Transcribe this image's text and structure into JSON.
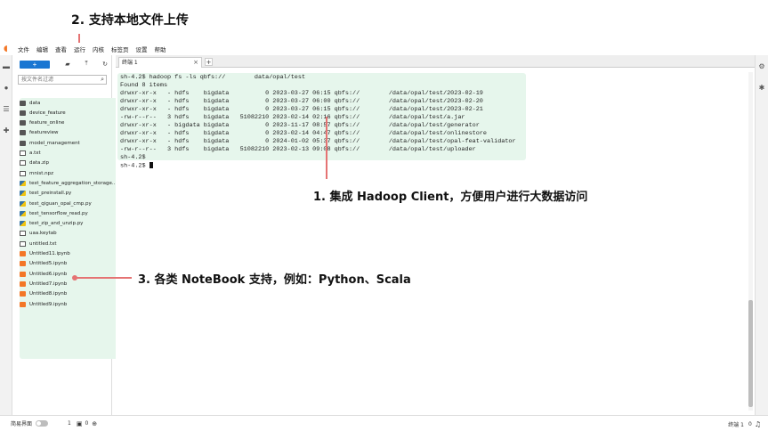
{
  "annotations": {
    "upload": "2. 支持本地文件上传",
    "hadoop": "1. 集成 Hadoop Client，方便用户进行大数据访问",
    "notebook": "3. 各类 NoteBook 支持，例如：Python、Scala"
  },
  "menu": [
    "文件",
    "编辑",
    "查看",
    "运行",
    "内核",
    "标签页",
    "设置",
    "帮助"
  ],
  "filebrowser": {
    "new_label": "+",
    "filter_placeholder": "按文件名过滤",
    "items": [
      {
        "name": "data",
        "type": "folder"
      },
      {
        "name": "device_feature",
        "type": "folder"
      },
      {
        "name": "feature_online",
        "type": "folder"
      },
      {
        "name": "featureview",
        "type": "folder"
      },
      {
        "name": "model_management",
        "type": "folder"
      },
      {
        "name": "a.txt",
        "type": "file"
      },
      {
        "name": "data.zip",
        "type": "file"
      },
      {
        "name": "mnist.npz",
        "type": "file"
      },
      {
        "name": "test_feature_aggregation_storage...",
        "type": "py"
      },
      {
        "name": "test_preinstall.py",
        "type": "py"
      },
      {
        "name": "test_qiguan_opal_cmp.py",
        "type": "py"
      },
      {
        "name": "test_tensorflow_read.py",
        "type": "py"
      },
      {
        "name": "test_zip_and_unzip.py",
        "type": "py"
      },
      {
        "name": "uaa.keytab",
        "type": "file"
      },
      {
        "name": "untitled.txt",
        "type": "file"
      },
      {
        "name": "Untitled11.ipynb",
        "type": "nb"
      },
      {
        "name": "Untitled5.ipynb",
        "type": "nb"
      },
      {
        "name": "Untitled6.ipynb",
        "type": "nb"
      },
      {
        "name": "Untitled7.ipynb",
        "type": "nb"
      },
      {
        "name": "Untitled8.ipynb",
        "type": "nb"
      },
      {
        "name": "Untitled9.ipynb",
        "type": "nb"
      }
    ]
  },
  "tab": {
    "label": "终端 1",
    "close": "×",
    "add": "+"
  },
  "terminal": {
    "lines": [
      "sh-4.2$ hadoop fs -ls qbfs://        data/opal/test",
      "Found 8 items",
      "drwxr-xr-x   - hdfs    bigdata          0 2023-03-27 06:15 qbfs://        /data/opal/test/2023-02-19",
      "drwxr-xr-x   - hdfs    bigdata          0 2023-03-27 06:00 qbfs://        /data/opal/test/2023-02-20",
      "drwxr-xr-x   - hdfs    bigdata          0 2023-03-27 06:15 qbfs://        /data/opal/test/2023-02-21",
      "-rw-r--r--   3 hdfs    bigdata   51082210 2023-02-14 02:16 qbfs://        /data/opal/test/a.jar",
      "drwxr-xr-x   - bigdata bigdata          0 2023-11-17 08:57 qbfs://        /data/opal/test/generator",
      "drwxr-xr-x   - hdfs    bigdata          0 2023-02-14 04:47 qbfs://        /data/opal/test/onlinestore",
      "drwxr-xr-x   - hdfs    bigdata          0 2024-01-02 05:37 qbfs://        /data/opal/test/opal-feat-validator",
      "-rw-r--r--   3 hdfs    bigdata   51082210 2023-02-13 09:08 qbfs://        /data/opal/test/uploader",
      "sh-4.2$",
      "sh-4.2$ "
    ]
  },
  "statusbar": {
    "simple_mode": "简易界面",
    "count_a": "1",
    "count_b": "0",
    "right_label": "终端 1",
    "right_count": "0"
  }
}
